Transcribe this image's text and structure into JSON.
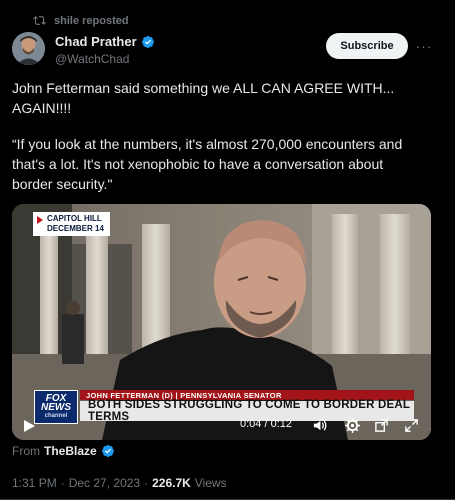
{
  "repost": {
    "text": "shile reposted",
    "icon": "repost-icon"
  },
  "author": {
    "display_name": "Chad Prather",
    "handle": "@WatchChad",
    "verified_color": "#1d9bf0"
  },
  "actions": {
    "subscribe_label": "Subscribe",
    "more_label": "···"
  },
  "tweet": {
    "paragraph1": "John Fetterman said something we ALL CAN AGREE WITH... AGAIN!!!!",
    "paragraph2": "“If you look at the numbers, it's almost 270,000 encounters and that's a lot. It's not xenophobic to have a conversation about border security.\""
  },
  "video": {
    "location_line1": "CAPITOL HILL",
    "location_line2": "DECEMBER 14",
    "logo_line1": "FOX",
    "logo_line2": "NEWS",
    "logo_line3": "channel",
    "name_strip": "JOHN FETTERMAN (D) | PENNSYLVANIA SENATOR",
    "headline": "BOTH SIDES STRUGGLING TO COME TO BORDER DEAL TERMS",
    "timecode": "0:04 / 0:12",
    "progress": 0.33
  },
  "source": {
    "prefix": "From",
    "name": "TheBlaze"
  },
  "meta": {
    "time": "1:31 PM",
    "separator": "·",
    "date": "Dec 27, 2023",
    "separator2": "·",
    "views_count": "226.7K",
    "views_label": "Views"
  },
  "colors": {
    "background": "#000000",
    "text": "#e7e9ea",
    "muted": "#71767b",
    "accent": "#1d9bf0"
  }
}
